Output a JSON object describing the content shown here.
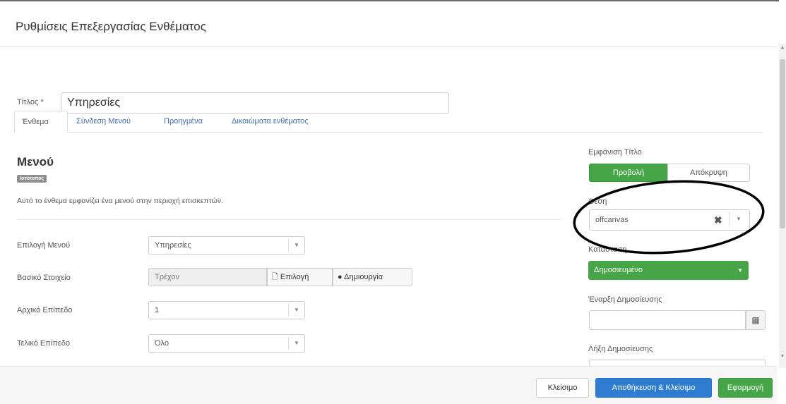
{
  "modal": {
    "title": "Ρυθμίσεις Επεξεργασίας Ενθέματος"
  },
  "title_field": {
    "label": "Τίτλος *",
    "value": "Υπηρεσίες"
  },
  "tabs": [
    {
      "label": "Ένθεμα",
      "active": true
    },
    {
      "label": "Σύνδεση Μενού",
      "active": false
    },
    {
      "label": "Προηγμένα",
      "active": false
    },
    {
      "label": "Δικαιώματα ενθέματος",
      "active": false
    }
  ],
  "module": {
    "heading": "Μενού",
    "badge": "Ιστότοπος",
    "description": "Αυτό το ένθεμα εμφανίζει ένα μενού στην περιοχή επισκεπτών."
  },
  "fields": {
    "menu": {
      "label": "Επιλογή Μενού",
      "value": "Υπηρεσίες"
    },
    "base_item": {
      "label": "Βασικό Στοιχείο",
      "value": "Τρέχον",
      "select_label": "Επιλογή",
      "create_label": "Δημιουργία"
    },
    "start_level": {
      "label": "Αρχικό Επίπεδο",
      "value": "1"
    },
    "end_level": {
      "label": "Τελικό Επίπεδο",
      "value": "Όλο"
    }
  },
  "sidebar": {
    "show_title": {
      "label": "Εμφάνιση Τίτλο",
      "show": "Προβολή",
      "hide": "Απόκρυψη"
    },
    "position": {
      "label": "Θέση",
      "value": "offcanvas"
    },
    "status": {
      "label": "Κατάσταση",
      "value": "Δημοσιευμένο"
    },
    "publish_up": {
      "label": "Έναρξη Δημοσίευσης",
      "value": ""
    },
    "publish_down": {
      "label": "Λήξη Δημοσίευσης"
    }
  },
  "footer": {
    "close": "Κλείσιμο",
    "save_close": "Αποθήκευση & Κλείσιμο",
    "apply": "Εφαρμογή"
  },
  "colors": {
    "success": "#46a546",
    "primary": "#2f7dd1",
    "annotation": "#000000"
  }
}
